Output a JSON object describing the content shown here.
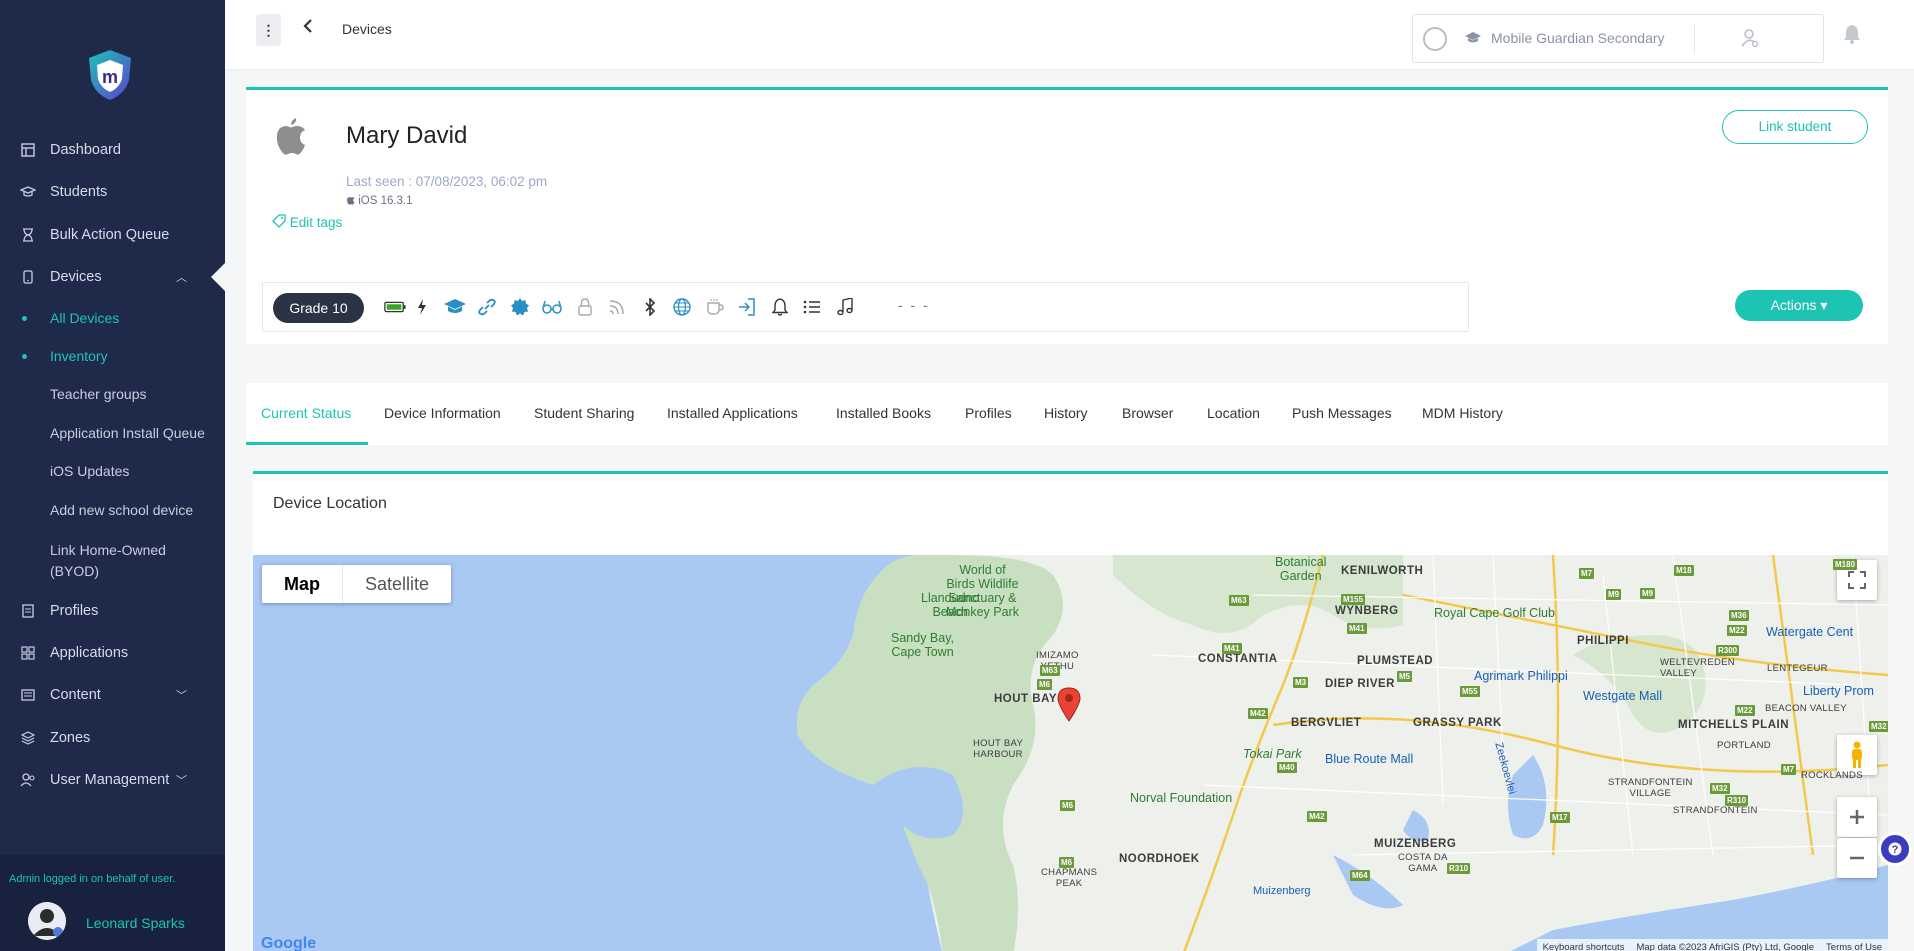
{
  "sidebar": {
    "nav": [
      {
        "label": "Dashboard",
        "icon": "dashboard-icon"
      },
      {
        "label": "Students",
        "icon": "graduation-cap-icon"
      },
      {
        "label": "Bulk Action Queue",
        "icon": "hourglass-icon"
      },
      {
        "label": "Devices",
        "icon": "mobile-device-icon"
      },
      {
        "label": "Profiles",
        "icon": "profiles-icon"
      },
      {
        "label": "Applications",
        "icon": "apps-grid-icon"
      },
      {
        "label": "Content",
        "icon": "content-icon"
      },
      {
        "label": "Zones",
        "icon": "zones-icon"
      },
      {
        "label": "User Management",
        "icon": "users-icon"
      }
    ],
    "devices_sub": [
      "All Devices",
      "Inventory",
      "Teacher groups",
      "Application Install Queue",
      "iOS Updates",
      "Add new school device",
      "Link Home-Owned (BYOD)"
    ],
    "admin_note": "Admin logged in on behalf of user.",
    "user_name": "Leonard Sparks"
  },
  "topbar": {
    "breadcrumb": "Devices",
    "school": "Mobile Guardian Secondary"
  },
  "device": {
    "name": "Mary David",
    "last_seen": "Last seen : 07/08/2023, 06:02 pm",
    "os": "iOS 16.3.1",
    "edit_tags": "Edit tags",
    "link_student": "Link student",
    "grade": "Grade 10",
    "actions": "Actions ▾",
    "dashes": "- - -"
  },
  "status_icons": [
    "battery-icon",
    "charging-icon",
    "graduation-cap-icon",
    "link-icon",
    "settings-badge-icon",
    "glasses-icon",
    "lock-icon",
    "wifi-icon",
    "bluetooth-icon",
    "globe-icon",
    "cup-icon",
    "login-icon",
    "bell-icon",
    "list-icon",
    "music-icon"
  ],
  "tabs": [
    "Current Status",
    "Device Information",
    "Student Sharing",
    "Installed Applications",
    "Installed Books",
    "Profiles",
    "History",
    "Browser",
    "Location",
    "Push Messages",
    "MDM History"
  ],
  "location": {
    "title": "Device Location",
    "map_type": {
      "map": "Map",
      "satellite": "Satellite"
    },
    "places": {
      "world_of_birds": "World of\nBirds Wildlife\nSanctuary &\nMonkey Park",
      "botanical": "Botanical\nGarden",
      "kenilworth": "KENILWORTH",
      "wynberg": "WYNBERG",
      "royal_cape": "Royal Cape Golf Club",
      "philippi": "PHILIPPI",
      "watergate": "Watergate Cent",
      "llandudno": "Llandudno\nBeach",
      "sandy_bay": "Sandy Bay,\nCape Town",
      "constantia": "CONSTANTIA",
      "plumstead": "PLUMSTEAD",
      "imizamo": "IMIZAMO\nYETHU",
      "diep_river": "DIEP RIVER",
      "agrimark": "Agrimark Philippi",
      "westgate": "Westgate Mall",
      "liberty": "Liberty Prom",
      "weltevreden": "WELTEVREDEN\nVALLEY",
      "lentegeur": "LENTEGEUR",
      "beacon_valley": "BEACON VALLEY",
      "hout_bay": "HOUT BAY",
      "bergvliet": "BERGVLIET",
      "grassy_park": "GRASSY PARK",
      "mitchells_plain": "MITCHELLS PLAIN",
      "hout_bay_harbour": "HOUT BAY\nHARBOUR",
      "zeekoevlei": "Zeekoevlei",
      "tokai": "Tokai Park",
      "blue_route": "Blue Route Mall",
      "portland": "PORTLAND",
      "norval": "Norval Foundation",
      "strandfontein_village": "STRANDFONTEIN\nVILLAGE",
      "rocklands": "ROCKLANDS",
      "strandfontein": "STRANDFONTEIN",
      "muizenberg": "MUIZENBERG",
      "noordhoek": "NOORDHOEK",
      "costa_da_gama": "COSTA DA\nGAMA",
      "chapmans_peak": "CHAPMANS\nPEAK",
      "muizenberg2": "Muizenberg"
    },
    "roads": [
      "M7",
      "M18",
      "M9",
      "M63",
      "M155",
      "M41",
      "M9",
      "M36",
      "M22",
      "R300",
      "M63",
      "M41",
      "M6",
      "M3",
      "M5",
      "M55",
      "M22",
      "M42",
      "M40",
      "M32",
      "M6",
      "M7",
      "M32",
      "R310",
      "M42",
      "M17",
      "M6",
      "M64",
      "R310",
      "M180"
    ],
    "attribution": [
      "Keyboard shortcuts",
      "Map data ©2023 AfriGIS (Pty) Ltd, Google",
      "Terms of Use"
    ],
    "google": "Google"
  }
}
